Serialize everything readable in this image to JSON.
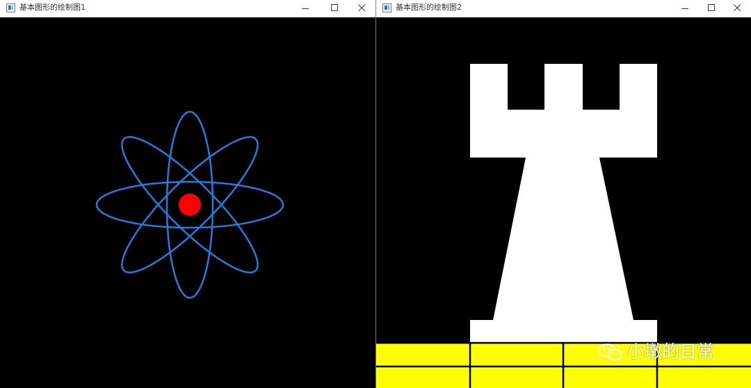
{
  "window1": {
    "title": "基本图形的绘制图1",
    "controls": {
      "minimize_icon": "minimize-icon",
      "maximize_icon": "maximize-icon",
      "close_icon": "close-icon"
    },
    "canvas": {
      "background": "#000000",
      "orbit_color": "#1f7fe0",
      "nucleus_color": "#ff0000"
    }
  },
  "window2": {
    "title": "基本图形的绘制图2",
    "controls": {
      "minimize_icon": "minimize-icon",
      "maximize_icon": "maximize-icon",
      "close_icon": "close-icon"
    },
    "canvas": {
      "background": "#000000",
      "rook_color": "#ffffff",
      "board_color": "#ffff00",
      "grid_color": "#000000"
    },
    "watermark": {
      "icon": "wechat-icon",
      "text": "小墩的日常"
    }
  }
}
